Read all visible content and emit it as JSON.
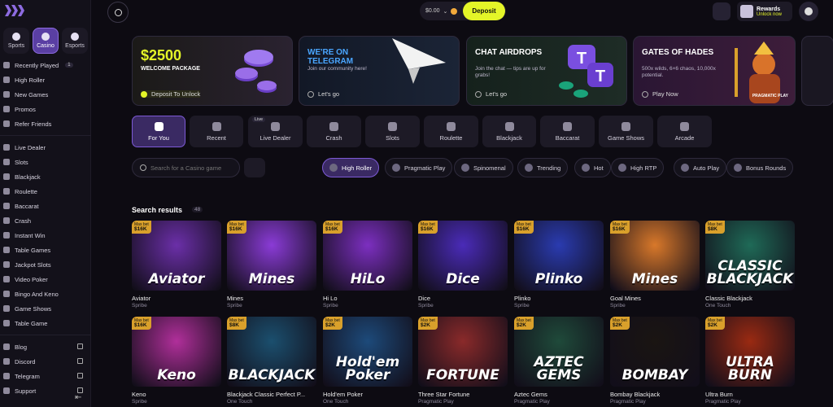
{
  "sidebar": {
    "segments": [
      {
        "label": "Sports",
        "icon": "sports-icon"
      },
      {
        "label": "Casino",
        "icon": "casino-icon"
      },
      {
        "label": "Esports",
        "icon": "esports-icon"
      }
    ],
    "nav_top": [
      {
        "label": "Recently Played",
        "badge": "1",
        "icon": "clock-icon"
      },
      {
        "label": "High Roller",
        "icon": "crown-icon"
      },
      {
        "label": "New Games",
        "icon": "star-icon"
      },
      {
        "label": "Promos",
        "icon": "gift-icon"
      },
      {
        "label": "Refer Friends",
        "icon": "users-icon"
      }
    ],
    "nav_games": [
      {
        "label": "Live Dealer",
        "icon": "live-dealer-icon"
      },
      {
        "label": "Slots",
        "icon": "slots-icon"
      },
      {
        "label": "Blackjack",
        "icon": "blackjack-icon"
      },
      {
        "label": "Roulette",
        "icon": "roulette-icon"
      },
      {
        "label": "Baccarat",
        "icon": "baccarat-icon"
      },
      {
        "label": "Crash",
        "icon": "crash-icon"
      },
      {
        "label": "Instant Win",
        "icon": "instant-win-icon"
      },
      {
        "label": "Table Games",
        "icon": "table-games-icon"
      },
      {
        "label": "Jackpot Slots",
        "icon": "jackpot-icon"
      },
      {
        "label": "Video Poker",
        "icon": "video-poker-icon"
      },
      {
        "label": "Bingo And Keno",
        "icon": "bingo-icon"
      },
      {
        "label": "Game Shows",
        "icon": "game-shows-icon"
      },
      {
        "label": "Table Game",
        "icon": "table-game-icon"
      }
    ],
    "nav_links": [
      {
        "label": "Blog",
        "icon": "blog-icon"
      },
      {
        "label": "Discord",
        "icon": "discord-icon"
      },
      {
        "label": "Telegram",
        "icon": "telegram-icon"
      },
      {
        "label": "Support",
        "icon": "support-icon"
      }
    ]
  },
  "topbar": {
    "balance": "$0.00",
    "deposit_label": "Deposit",
    "rewards_title": "Rewards",
    "rewards_sub": "Unlock now"
  },
  "banners": [
    {
      "title": "$2500",
      "subtitle": "WELCOME PACKAGE",
      "cta": "Deposit To Unlock"
    },
    {
      "title": "WE'RE ON TELEGRAM",
      "subtitle": "Join our community here!",
      "cta": "Let's go"
    },
    {
      "title": "CHAT AIRDROPS",
      "subtitle": "Join the chat — tips are up for grabs!",
      "cta": "Let's go"
    },
    {
      "title": "GATES OF HADES",
      "subtitle": "500x wilds, 6×6 chaos, 10,000x potential.",
      "cta": "Play Now",
      "tag": "PRAGMATIC PLAY"
    }
  ],
  "categories": [
    {
      "label": "For You",
      "icon": "home-icon"
    },
    {
      "label": "Recent",
      "icon": "clock-icon"
    },
    {
      "label": "Live Dealer",
      "icon": "live-dealer-icon",
      "tag": "Live"
    },
    {
      "label": "Crash",
      "icon": "crash-icon"
    },
    {
      "label": "Slots",
      "icon": "slots-icon"
    },
    {
      "label": "Roulette",
      "icon": "roulette-icon"
    },
    {
      "label": "Blackjack",
      "icon": "blackjack-icon"
    },
    {
      "label": "Baccarat",
      "icon": "baccarat-icon"
    },
    {
      "label": "Game Shows",
      "icon": "game-shows-icon"
    },
    {
      "label": "Arcade",
      "icon": "arcade-icon"
    }
  ],
  "search": {
    "placeholder": "Search for a Casino game"
  },
  "filters": [
    "High Roller",
    "Pragmatic Play",
    "Spinomenal",
    "Trending",
    "Hot",
    "High RTP",
    "Auto Play",
    "Bonus Rounds"
  ],
  "results": {
    "title": "Search results",
    "count": "48",
    "maxbet_label": "Max bet",
    "games": [
      {
        "name": "Aviator",
        "provider": "Spribe",
        "maxbet": "$16K",
        "art": "Aviator",
        "bg": "#6b2fa8"
      },
      {
        "name": "Mines",
        "provider": "Spribe",
        "maxbet": "$16K",
        "art": "Mines",
        "bg": "#8a3bd6"
      },
      {
        "name": "Hi Lo",
        "provider": "Spribe",
        "maxbet": "$16K",
        "art": "HiLo",
        "bg": "#7c2fc0"
      },
      {
        "name": "Dice",
        "provider": "Spribe",
        "maxbet": "$16K",
        "art": "Dice",
        "bg": "#4a2bb8"
      },
      {
        "name": "Plinko",
        "provider": "Spribe",
        "maxbet": "$16K",
        "art": "Plinko",
        "bg": "#2a3bb0"
      },
      {
        "name": "Goal Mines",
        "provider": "Spribe",
        "maxbet": "$16K",
        "art": "Mines",
        "bg": "#d8782a"
      },
      {
        "name": "Classic Blackjack",
        "provider": "One Touch",
        "maxbet": "$8K",
        "art": "CLASSIC BLACKJACK",
        "bg": "#1f6a57"
      },
      {
        "name": "Keno",
        "provider": "Spribe",
        "maxbet": "$16K",
        "art": "Keno",
        "bg": "#b02f9a"
      },
      {
        "name": "Blackjack Classic Perfect P...",
        "provider": "One Touch",
        "maxbet": "$8K",
        "art": "BLACKJACK",
        "bg": "#1b4f6e"
      },
      {
        "name": "Hold'em Poker",
        "provider": "One Touch",
        "maxbet": "$2K",
        "art": "Hold'em Poker",
        "bg": "#1d4a7a"
      },
      {
        "name": "Three Star Fortune",
        "provider": "Pragmatic Play",
        "maxbet": "$2K",
        "art": "FORTUNE",
        "bg": "#8a2a2a"
      },
      {
        "name": "Aztec Gems",
        "provider": "Pragmatic Play",
        "maxbet": "$2K",
        "art": "AZTEC GEMS",
        "bg": "#1f4a3a"
      },
      {
        "name": "Bombay Blackjack",
        "provider": "Pragmatic Play",
        "maxbet": "$2K",
        "art": "BOMBAY",
        "bg": "#1a1512"
      },
      {
        "name": "Ultra Burn",
        "provider": "Pragmatic Play",
        "maxbet": "$2K",
        "art": "ULTRA BURN",
        "bg": "#9a2a12"
      }
    ]
  }
}
